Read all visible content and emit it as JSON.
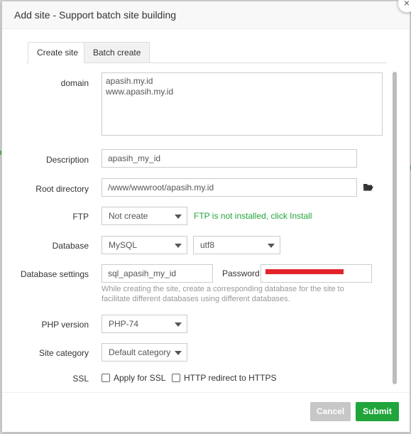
{
  "dialog": {
    "title": "Add site - Support batch site building"
  },
  "tabs": [
    {
      "label": "Create site"
    },
    {
      "label": "Batch create"
    }
  ],
  "form": {
    "domain": {
      "label": "domain",
      "lines": [
        "apasih.my.id",
        "www.apasih.my.id"
      ]
    },
    "description": {
      "label": "Description",
      "value": "apasih_my_id"
    },
    "root": {
      "label": "Root directory",
      "value": "/www/wwwroot/apasih.my.id"
    },
    "ftp": {
      "label": "FTP",
      "selected": "Not create",
      "hint": "FTP is not installed, click Install"
    },
    "database": {
      "label": "Database",
      "type": "MySQL",
      "charset": "utf8"
    },
    "db_settings": {
      "label": "Database settings",
      "name": "sql_apasih_my_id",
      "password_label": "Password",
      "hint": "While creating the site, create a corresponding database for the site to facilitate different databases using different databases."
    },
    "php": {
      "label": "PHP version",
      "selected": "PHP-74"
    },
    "category": {
      "label": "Site category",
      "selected": "Default category"
    },
    "ssl": {
      "label": "SSL",
      "apply": "Apply for SSL",
      "redirect": "HTTP redirect to HTTPS"
    }
  },
  "footer": {
    "cancel": "Cancel",
    "submit": "Submit"
  },
  "colors": {
    "accent": "#20a53a",
    "redaction": "#e2232a"
  }
}
